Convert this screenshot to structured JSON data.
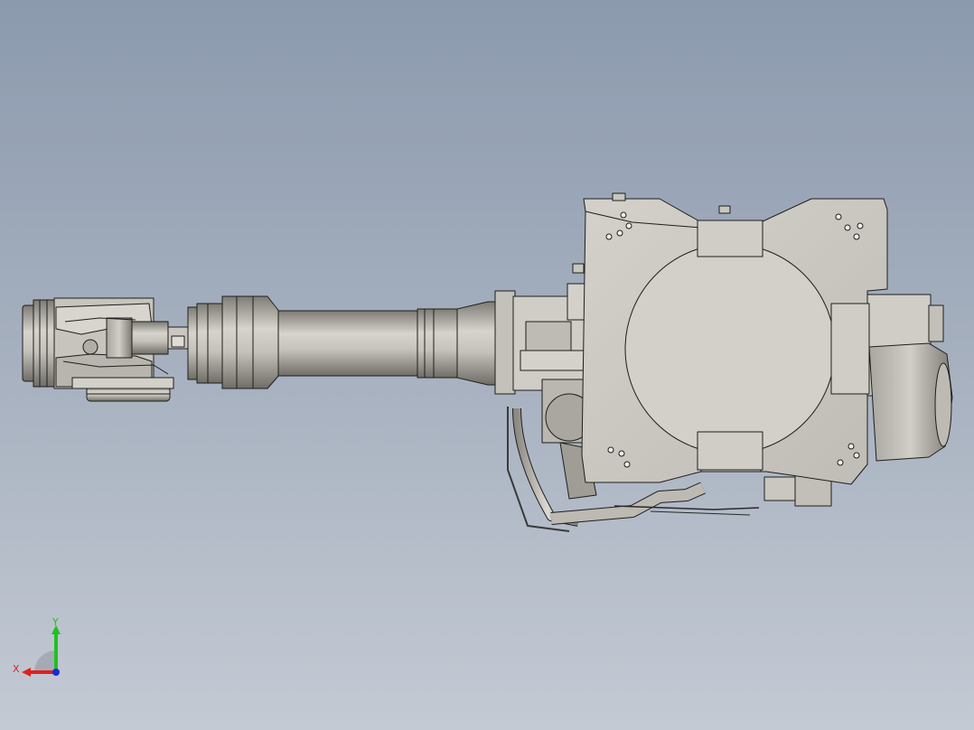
{
  "viewport": {
    "background_top": "#8c9aae",
    "background_bottom": "#c4cad4"
  },
  "model": {
    "part_fill": "#c9c7bf",
    "part_shade": "#8f8d85",
    "edge_color": "#1e1e1e"
  },
  "triad": {
    "x_label": "X",
    "y_label": "Y",
    "x_color": "#e02020",
    "y_color": "#1fc21f",
    "z_color": "#1a2ad6"
  }
}
